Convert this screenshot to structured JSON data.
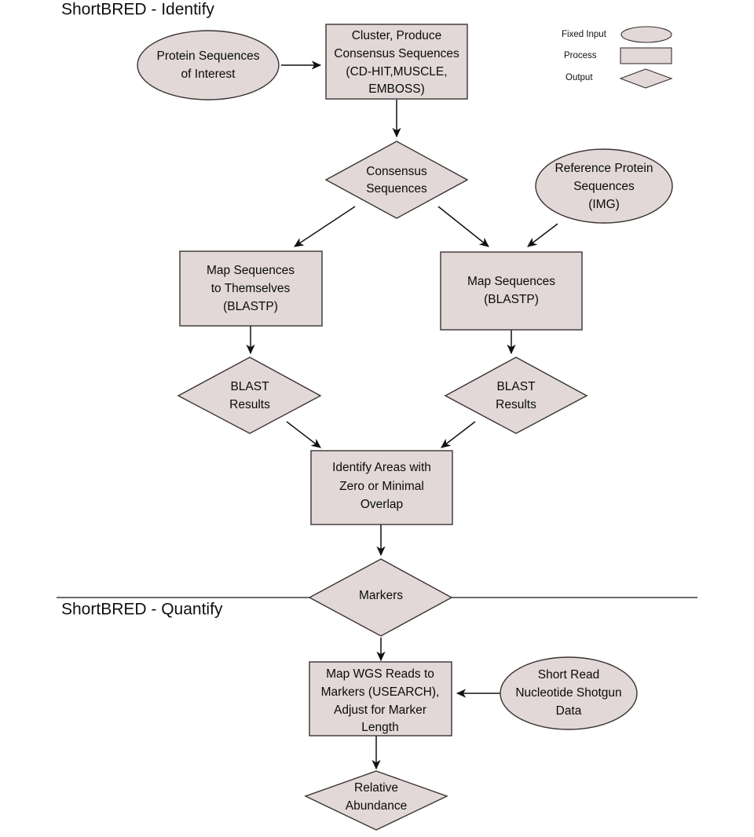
{
  "sections": {
    "identify_title": "ShortBRED - Identify",
    "quantify_title": "ShortBRED - Quantify"
  },
  "legend": {
    "items": [
      {
        "label": "Fixed Input",
        "shape": "ellipse"
      },
      {
        "label": "Process",
        "shape": "rectangle"
      },
      {
        "label": "Output",
        "shape": "diamond"
      }
    ]
  },
  "colors": {
    "shape_fill": "#e1d8d7",
    "shape_stroke": "#3b3233",
    "text": "#0b0b0b",
    "edge": "#111111",
    "background": "#ffffff"
  },
  "nodes": [
    {
      "id": "protein-sequences-of-interest",
      "type": "ellipse",
      "lines": [
        "Protein Sequences",
        "of Interest"
      ]
    },
    {
      "id": "cluster-produce-consensus-sequences",
      "type": "rectangle",
      "lines": [
        "Cluster, Produce",
        "Consensus Sequences",
        "(CD-HIT,MUSCLE,",
        "EMBOSS)"
      ]
    },
    {
      "id": "consensus-sequences",
      "type": "diamond",
      "lines": [
        "Consensus",
        "Sequences"
      ]
    },
    {
      "id": "reference-protein-sequences-img",
      "type": "ellipse",
      "lines": [
        "Reference Protein",
        "Sequences",
        "(IMG)"
      ]
    },
    {
      "id": "map-sequences-to-themselves-blastp",
      "type": "rectangle",
      "lines": [
        "Map Sequences",
        "to Themselves",
        "(BLASTP)"
      ]
    },
    {
      "id": "map-sequences-blastp",
      "type": "rectangle",
      "lines": [
        "Map Sequences",
        "(BLASTP)"
      ]
    },
    {
      "id": "blast-results-left",
      "type": "diamond",
      "lines": [
        "BLAST",
        "Results"
      ]
    },
    {
      "id": "blast-results-right",
      "type": "diamond",
      "lines": [
        "BLAST",
        "Results"
      ]
    },
    {
      "id": "identify-areas-with-zero-or-minimal-overlap",
      "type": "rectangle",
      "lines": [
        "Identify Areas with",
        "Zero or Minimal",
        "Overlap"
      ]
    },
    {
      "id": "markers",
      "type": "diamond",
      "lines": [
        "Markers"
      ]
    },
    {
      "id": "map-wgs-reads-to-markers",
      "type": "rectangle",
      "lines": [
        "Map WGS Reads to",
        "Markers (USEARCH),",
        "Adjust for Marker",
        "Length"
      ]
    },
    {
      "id": "short-read-nucleotide-shotgun-data",
      "type": "ellipse",
      "lines": [
        "Short Read",
        "Nucleotide Shotgun",
        "Data"
      ]
    },
    {
      "id": "relative-abundance",
      "type": "diamond",
      "lines": [
        "Relative",
        "Abundance"
      ]
    }
  ],
  "text": {
    "protein_l1": "Protein Sequences",
    "protein_l2": "of Interest",
    "cluster_l1": "Cluster, Produce",
    "cluster_l2": "Consensus Sequences",
    "cluster_l3": "(CD-HIT,MUSCLE,",
    "cluster_l4": "EMBOSS)",
    "consensus_l1": "Consensus",
    "consensus_l2": "Sequences",
    "reference_l1": "Reference Protein",
    "reference_l2": "Sequences",
    "reference_l3": "(IMG)",
    "mapself_l1": "Map Sequences",
    "mapself_l2": "to Themselves",
    "mapself_l3": "(BLASTP)",
    "mapseq_l1": "Map Sequences",
    "mapseq_l2": "(BLASTP)",
    "blastleft_l1": "BLAST",
    "blastleft_l2": "Results",
    "blastright_l1": "BLAST",
    "blastright_l2": "Results",
    "identify_l1": "Identify Areas with",
    "identify_l2": "Zero or Minimal",
    "identify_l3": "Overlap",
    "markers_l1": "Markers",
    "wgs_l1": "Map WGS Reads to",
    "wgs_l2": "Markers (USEARCH),",
    "wgs_l3": "Adjust for Marker",
    "wgs_l4": "Length",
    "shortread_l1": "Short Read",
    "shortread_l2": "Nucleotide Shotgun",
    "shortread_l3": "Data",
    "relative_l1": "Relative",
    "relative_l2": "Abundance",
    "legend_fixed_input": "Fixed Input",
    "legend_process": "Process",
    "legend_output": "Output",
    "title_identify": "ShortBRED - Identify",
    "title_quantify": "ShortBRED - Quantify"
  },
  "edges": [
    {
      "from": "protein-sequences-of-interest",
      "to": "cluster-produce-consensus-sequences"
    },
    {
      "from": "cluster-produce-consensus-sequences",
      "to": "consensus-sequences"
    },
    {
      "from": "consensus-sequences",
      "to": "map-sequences-to-themselves-blastp"
    },
    {
      "from": "consensus-sequences",
      "to": "map-sequences-blastp"
    },
    {
      "from": "reference-protein-sequences-img",
      "to": "map-sequences-blastp"
    },
    {
      "from": "map-sequences-to-themselves-blastp",
      "to": "blast-results-left"
    },
    {
      "from": "map-sequences-blastp",
      "to": "blast-results-right"
    },
    {
      "from": "blast-results-left",
      "to": "identify-areas-with-zero-or-minimal-overlap"
    },
    {
      "from": "blast-results-right",
      "to": "identify-areas-with-zero-or-minimal-overlap"
    },
    {
      "from": "identify-areas-with-zero-or-minimal-overlap",
      "to": "markers"
    },
    {
      "from": "markers",
      "to": "map-wgs-reads-to-markers"
    },
    {
      "from": "short-read-nucleotide-shotgun-data",
      "to": "map-wgs-reads-to-markers"
    },
    {
      "from": "map-wgs-reads-to-markers",
      "to": "relative-abundance"
    }
  ]
}
